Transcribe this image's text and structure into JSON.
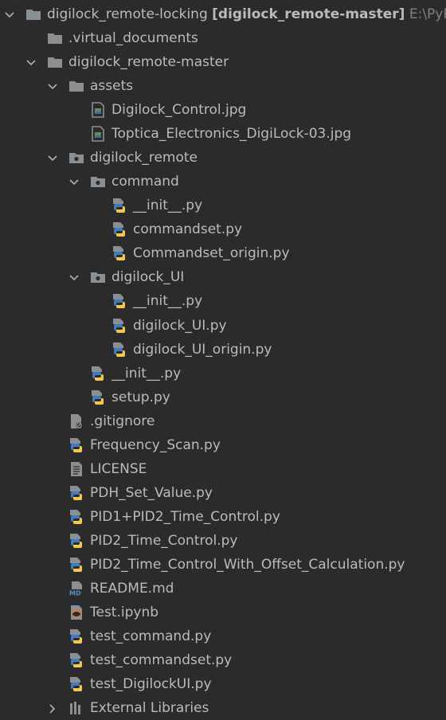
{
  "colors": {
    "background": "#2b2b2b",
    "text": "#bbbbbb",
    "folder": "#8a8f94",
    "python_blue": "#3f7cbf",
    "python_yellow": "#f2c94c",
    "jupyter_orange": "#e67a30"
  },
  "tree": [
    {
      "label": "digilock_remote-locking",
      "bold": "[digilock_remote-master]",
      "path": "E:\\PyP",
      "icon": "folder-icon",
      "expanded": true
    },
    {
      "label": ".virtual_documents",
      "icon": "folder-icon"
    },
    {
      "label": "digilock_remote-master",
      "icon": "folder-icon",
      "expanded": true
    },
    {
      "label": "assets",
      "icon": "folder-icon",
      "expanded": true
    },
    {
      "label": "Digilock_Control.jpg",
      "icon": "image-file-icon"
    },
    {
      "label": "Toptica_Electronics_DigiLock-03.jpg",
      "icon": "image-file-icon"
    },
    {
      "label": "digilock_remote",
      "icon": "package-folder-icon",
      "expanded": true
    },
    {
      "label": "command",
      "icon": "package-folder-icon",
      "expanded": true
    },
    {
      "label": "__init__.py",
      "icon": "python-file-icon"
    },
    {
      "label": "commandset.py",
      "icon": "python-file-icon"
    },
    {
      "label": "Commandset_origin.py",
      "icon": "python-file-icon"
    },
    {
      "label": "digilock_UI",
      "icon": "package-folder-icon",
      "expanded": true
    },
    {
      "label": "__init__.py",
      "icon": "python-file-icon"
    },
    {
      "label": "digilock_UI.py",
      "icon": "python-file-icon"
    },
    {
      "label": "digilock_UI_origin.py",
      "icon": "python-file-icon"
    },
    {
      "label": "__init__.py",
      "icon": "python-file-icon"
    },
    {
      "label": "setup.py",
      "icon": "python-file-icon"
    },
    {
      "label": ".gitignore",
      "icon": "ignore-file-icon"
    },
    {
      "label": "Frequency_Scan.py",
      "icon": "python-file-icon"
    },
    {
      "label": "LICENSE",
      "icon": "text-file-icon"
    },
    {
      "label": "PDH_Set_Value.py",
      "icon": "python-file-icon"
    },
    {
      "label": "PID1+PID2_Time_Control.py",
      "icon": "python-file-icon"
    },
    {
      "label": "PID2_Time_Control.py",
      "icon": "python-file-icon"
    },
    {
      "label": "PID2_Time_Control_With_Offset_Calculation.py",
      "icon": "python-file-icon"
    },
    {
      "label": "README.md",
      "icon": "markdown-file-icon"
    },
    {
      "label": "Test.ipynb",
      "icon": "jupyter-file-icon"
    },
    {
      "label": "test_command.py",
      "icon": "python-file-icon"
    },
    {
      "label": "test_commandset.py",
      "icon": "python-file-icon"
    },
    {
      "label": "test_DigilockUI.py",
      "icon": "python-file-icon"
    },
    {
      "label": "External Libraries",
      "icon": "libraries-icon",
      "expanded": false
    }
  ]
}
